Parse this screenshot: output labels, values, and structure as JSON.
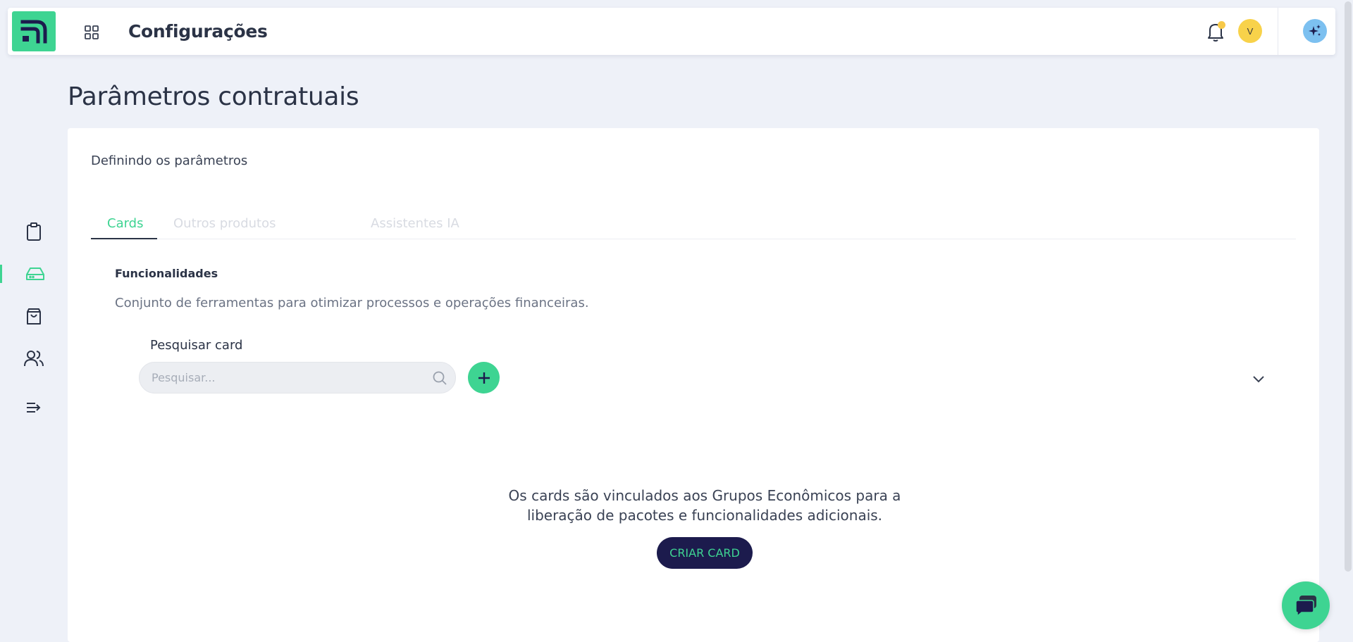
{
  "header": {
    "title": "Configurações",
    "avatar_initial": "V",
    "logo_icon": "brand-logo-icon",
    "apps_icon": "grid-icon",
    "bell_icon": "bell-icon",
    "ai_icon": "sparkles-icon"
  },
  "sidebar": {
    "items": [
      {
        "name": "clipboard-icon",
        "active": false
      },
      {
        "name": "inbox-icon",
        "active": true
      },
      {
        "name": "shopping-bag-icon",
        "active": false
      },
      {
        "name": "users-icon",
        "active": false
      },
      {
        "name": "expand-menu-icon",
        "active": false
      }
    ]
  },
  "page": {
    "title": "Parâmetros contratuais",
    "card_subtitle": "Definindo os parâmetros",
    "tabs": [
      {
        "label": "Cards",
        "active": true
      },
      {
        "label": "Outros produtos",
        "active": false
      },
      {
        "label": "Assistentes IA",
        "active": false
      }
    ],
    "section_title": "Funcionalidades",
    "section_desc": "Conjunto de ferramentas para otimizar processos e operações financeiras.",
    "search": {
      "label": "Pesquisar card",
      "placeholder": "Pesquisar...",
      "value": ""
    },
    "empty_state": {
      "line1": "Os cards são vinculados aos Grupos Econômicos para a",
      "line2": "liberação de pacotes e funcionalidades adicionais.",
      "button": "CRIAR CARD"
    }
  },
  "colors": {
    "accent": "#3ed492",
    "dark": "#1c1b4d",
    "background": "#eef1f8",
    "notification_dot": "#f7c948",
    "avatar": "#f8d24a"
  }
}
